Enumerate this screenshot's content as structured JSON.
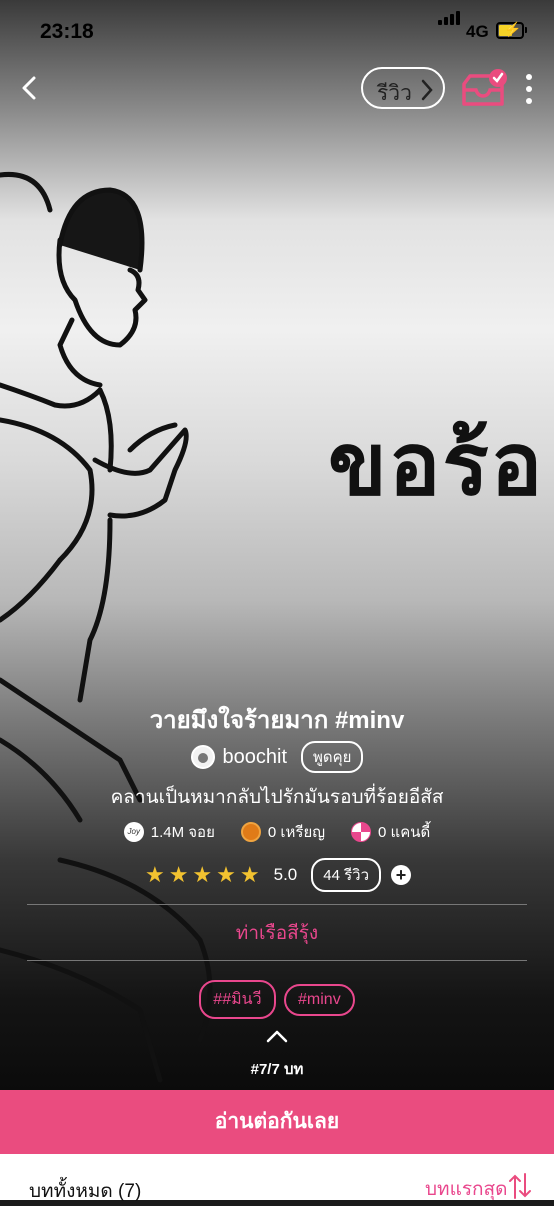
{
  "status_bar": {
    "time": "23:18",
    "network": "4G"
  },
  "header": {
    "review_label": "รีวิว"
  },
  "cover": {
    "overlay_text": "ขอร้อ"
  },
  "story": {
    "title": "วายมึงใจร้ายมาก #minv",
    "author": "boochit",
    "talk_label": "พูดคุย",
    "description": "คลานเป็นหมากลับไปรักมันรอบที่ร้อยอีสัส",
    "stats": {
      "joy": "1.4M จอย",
      "coins": "0 เหรียญ",
      "candy": "0 แคนดี้"
    },
    "rating": {
      "stars": 5,
      "score": "5.0",
      "review_count": "44 รีวิว"
    },
    "category": "ท่าเรือสีรุ้ง",
    "tags": [
      "##มินวี",
      "#minv"
    ],
    "episode_progress": "#7/7 บท"
  },
  "cta": {
    "label": "อ่านต่อกันเลย"
  },
  "episodes": {
    "all_label": "บททั้งหมด (7)",
    "first_label": "บทแรกสุด"
  },
  "colors": {
    "accent": "#ea4c7f",
    "star": "#f2c230"
  }
}
